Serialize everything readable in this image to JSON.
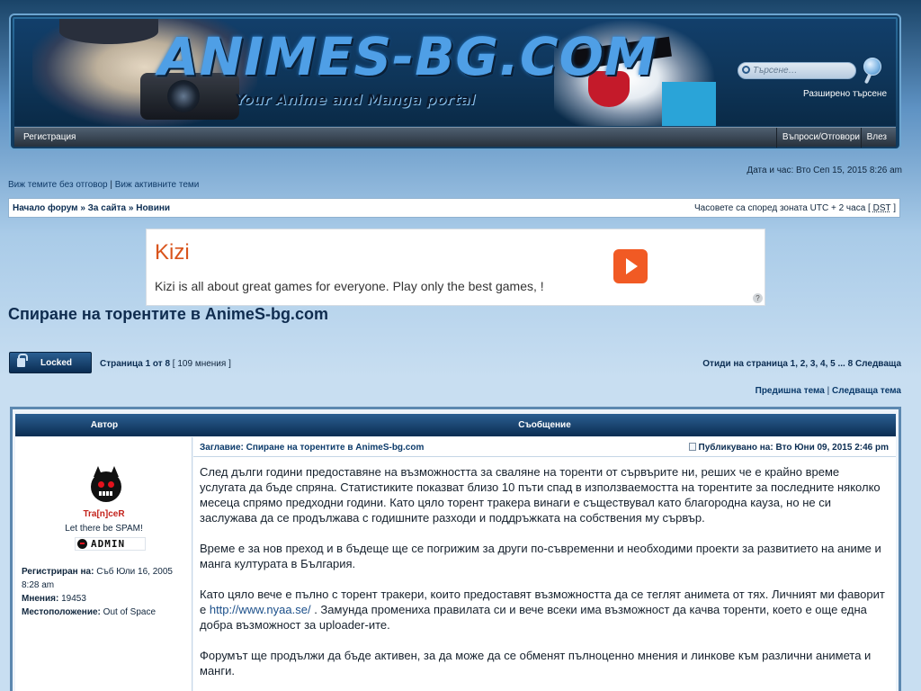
{
  "header": {
    "logo_title": "ANIMES-BG.COM",
    "logo_tagline": "Your Anime and Manga portal",
    "search_placeholder": "Търсене…",
    "advanced_search": "Разширено търсене"
  },
  "nav": {
    "register": "Регистрация",
    "faq": "Въпроси/Отговори",
    "login": "Влез"
  },
  "info": {
    "datetime": "Дата и час: Вто Сеп 15, 2015 8:26 am",
    "unanswered": "Виж темите без отговор",
    "separator": " | ",
    "active": "Виж активните теми"
  },
  "breadcrumb": {
    "text": "Начало форум » За сайта » Новини",
    "timezone_prefix": "Часовете са според зоната UTC + 2 часа [ ",
    "dst": "DST",
    "timezone_suffix": " ]"
  },
  "ad": {
    "title": "Kizi",
    "description": "Kizi is all about great games for everyone. Play only the best games, !",
    "info": "?"
  },
  "topic": {
    "title": "Спиране на торентите в AnimeS-bg.com",
    "locked_label": "Locked",
    "page_label": "Страница 1 от 8",
    "page_count": " [ 109 мнения ]",
    "pagination": "Отиди на страница 1, 2, 3, 4, 5 ... 8  Следваща",
    "prev_topic": "Предишна тема",
    "nav_sep": " | ",
    "next_topic": "Следваща тема"
  },
  "post_table": {
    "col_author": "Автор",
    "col_message": "Съобщение"
  },
  "author": {
    "username": "Tra[n]ceR",
    "user_title": "Let there be SPAM!",
    "rank": "ADMIN",
    "registered_label": "Регистриран на:",
    "registered_value": " Съб Юли 16, 2005 8:28 am",
    "posts_label": "Мнения:",
    "posts_value": " 19453",
    "location_label": "Местоположение:",
    "location_value": " Out of Space"
  },
  "post": {
    "subject": "Заглавие: Спиране на торентите в AnimeS-bg.com",
    "posted": "Публикувано на: Вто Юни 09, 2015 2:46 pm",
    "p1": "След дълги години предоставяне на възможността за сваляне на торенти от сървърите ни, реших че е крайно време услугата да бъде спряна. Статистиките показват близо 10 пъти спад в използваемостта на торентите за последните няколко месеца спрямо предходни години. Като цяло торент тракера винаги е съществувал като благородна кауза, но не си заслужава да се продължава с годишните разходи и поддръжката на собствения му сървър.",
    "p2": "Време е за нов преход и в бъдеще ще се погрижим за други по-съвременни и необходими проекти за развитието на аниме и манга културата в България.",
    "p3_a": "Като цяло вече е пълно с торент тракери, които предоставят възможността да се теглят анимета от тях. Личният ми фаворит е ",
    "p3_link": "http://www.nyaa.se/",
    "p3_b": " . Замунда промениха правилата си и вече всеки има възможност да качва торенти, което е още една добра възможност за uploader-ите.",
    "p4": "Форумът ще продължи да бъде активен, за да може да се обменят пълноценно мнения и линкове към различни анимета и манги."
  },
  "colors": {
    "accent": "#0b2d52",
    "username": "#c3231c",
    "ad_button": "#f15a24"
  }
}
